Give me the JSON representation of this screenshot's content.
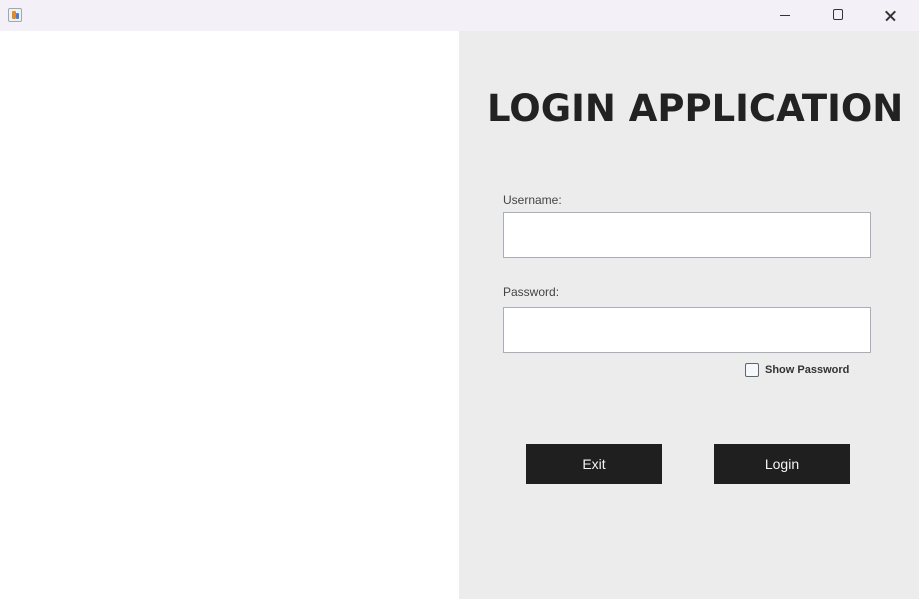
{
  "window": {
    "icon": "java-cup-icon",
    "controls": {
      "minimize": "minimize-icon",
      "maximize": "maximize-icon",
      "close": "close-icon"
    }
  },
  "login": {
    "title": "LOGIN APPLICATION",
    "username_label": "Username:",
    "username_value": "",
    "password_label": "Password:",
    "password_value": "",
    "show_password_label": "Show Password",
    "show_password_checked": false,
    "exit_label": "Exit",
    "login_label": "Login"
  },
  "colors": {
    "titlebar": "#f3f0f7",
    "panel": "#ececec",
    "button": "#1f1f1f",
    "button_text": "#f4f4f4"
  }
}
